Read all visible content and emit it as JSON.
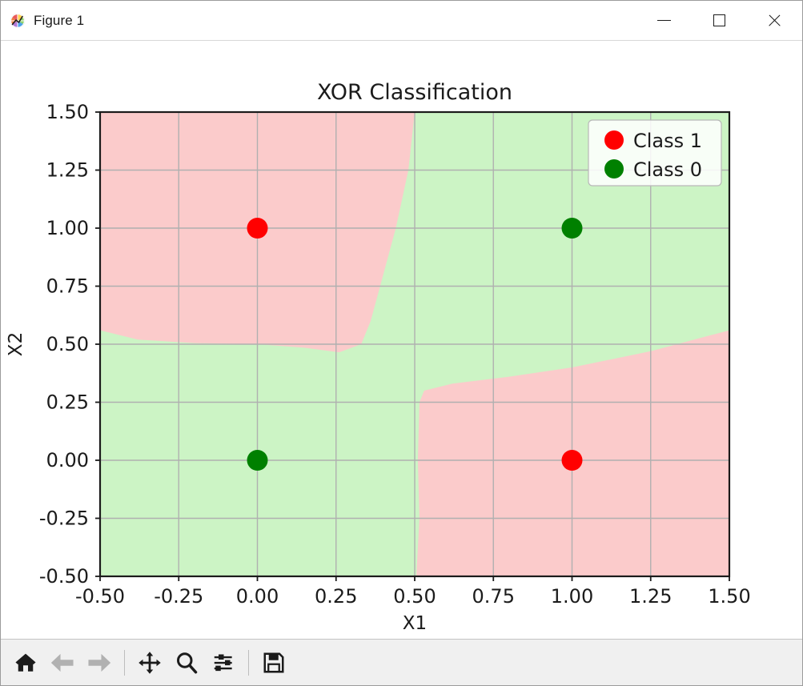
{
  "window": {
    "title": "Figure 1",
    "icon": "matplotlib-icon",
    "controls": {
      "minimize_label": "Minimize",
      "maximize_label": "Maximize",
      "close_label": "Close"
    }
  },
  "toolbar": {
    "items": [
      {
        "name": "home-icon",
        "label": "Home",
        "enabled": true
      },
      {
        "name": "back-arrow-icon",
        "label": "Back",
        "enabled": false
      },
      {
        "name": "forward-arrow-icon",
        "label": "Forward",
        "enabled": false
      },
      {
        "name": "pan-icon",
        "label": "Pan",
        "enabled": true
      },
      {
        "name": "zoom-icon",
        "label": "Zoom",
        "enabled": true
      },
      {
        "name": "configure-subplots-icon",
        "label": "Configure subplots",
        "enabled": true
      },
      {
        "name": "save-icon",
        "label": "Save",
        "enabled": true
      }
    ]
  },
  "chart_data": {
    "type": "scatter",
    "title": "XOR Classification",
    "xlabel": "X1",
    "ylabel": "X2",
    "xlim": [
      -0.5,
      1.5
    ],
    "ylim": [
      -0.5,
      1.5
    ],
    "grid": true,
    "xticks": [
      "-0.50",
      "-0.25",
      "0.00",
      "0.25",
      "0.50",
      "0.75",
      "1.00",
      "1.25",
      "1.50"
    ],
    "xtick_values": [
      -0.5,
      -0.25,
      0,
      0.25,
      0.5,
      0.75,
      1,
      1.25,
      1.5
    ],
    "yticks": [
      "-0.50",
      "-0.25",
      "0.00",
      "0.25",
      "0.50",
      "0.75",
      "1.00",
      "1.25",
      "1.50"
    ],
    "ytick_values": [
      -0.5,
      -0.25,
      0,
      0.25,
      0.5,
      0.75,
      1,
      1.25,
      1.5
    ],
    "legend": {
      "position": "upper right",
      "entries": [
        {
          "label": "Class 1",
          "color": "#ff0000",
          "marker": "circle"
        },
        {
          "label": "Class 0",
          "color": "#008000",
          "marker": "circle"
        }
      ]
    },
    "series": [
      {
        "name": "Class 1",
        "color": "#ff0000",
        "points": [
          {
            "x": 0,
            "y": 1
          },
          {
            "x": 1,
            "y": 0
          }
        ]
      },
      {
        "name": "Class 0",
        "color": "#008000",
        "points": [
          {
            "x": 0,
            "y": 0
          },
          {
            "x": 1,
            "y": 1
          }
        ]
      }
    ],
    "decision_regions": {
      "class1_fill": "#fbcbcb",
      "class0_fill": "#ccf4c5",
      "description": "XOR decision surface: class-1 (pink) occupies the upper-left and lower-right quadrants; class-0 (green) occupies the lower-left and upper-right quadrants.",
      "boundary_upper_left": [
        {
          "x": -0.5,
          "y": 0.56
        },
        {
          "x": -0.38,
          "y": 0.52
        },
        {
          "x": -0.2,
          "y": 0.505
        },
        {
          "x": 0.0,
          "y": 0.5
        },
        {
          "x": 0.15,
          "y": 0.485
        },
        {
          "x": 0.26,
          "y": 0.465
        },
        {
          "x": 0.33,
          "y": 0.5
        },
        {
          "x": 0.36,
          "y": 0.6
        },
        {
          "x": 0.39,
          "y": 0.75
        },
        {
          "x": 0.44,
          "y": 1.0
        },
        {
          "x": 0.48,
          "y": 1.25
        },
        {
          "x": 0.5,
          "y": 1.5
        }
      ],
      "boundary_lower_right": [
        {
          "x": 0.505,
          "y": -0.5
        },
        {
          "x": 0.515,
          "y": -0.25
        },
        {
          "x": 0.51,
          "y": 0.0
        },
        {
          "x": 0.515,
          "y": 0.25
        },
        {
          "x": 0.53,
          "y": 0.3
        },
        {
          "x": 0.62,
          "y": 0.33
        },
        {
          "x": 0.8,
          "y": 0.36
        },
        {
          "x": 1.0,
          "y": 0.4
        },
        {
          "x": 1.25,
          "y": 0.47
        },
        {
          "x": 1.5,
          "y": 0.56
        }
      ]
    }
  }
}
